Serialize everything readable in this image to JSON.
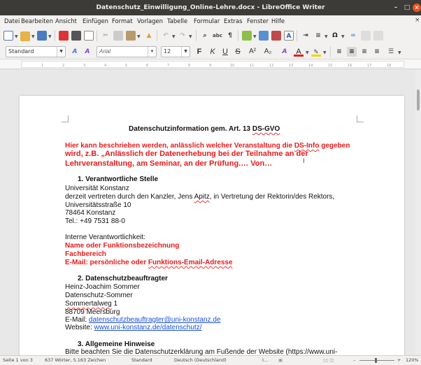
{
  "window": {
    "title": "Datenschutz_Einwilligung_Online-Lehre.docx - LibreOffice Writer",
    "min": "–",
    "max": "□",
    "close": "×"
  },
  "menu": [
    "Datei",
    "Bearbeiten",
    "Ansicht",
    "Einfügen",
    "Format",
    "Vorlagen",
    "Tabelle",
    "Formular",
    "Extras",
    "Fenster",
    "Hilfe"
  ],
  "menu_close": "×",
  "toolbar2": {
    "paragraph_style": "Standard",
    "font_name": "Arial",
    "font_size": "12",
    "bold": "F",
    "italic": "K",
    "underline": "U",
    "strike": "S",
    "superscript": "A²",
    "subscript": "A₂",
    "font_color": "A",
    "highlight": "✎"
  },
  "ruler": [
    "1",
    "2",
    "3",
    "4",
    "5",
    "6",
    "7",
    "8",
    "9",
    "10",
    "11",
    "12",
    "13",
    "14",
    "15",
    "16",
    "17",
    "18"
  ],
  "document": {
    "title": "Datenschutzinformation gem. Art. 13 ",
    "title_tail": "DS-GVO",
    "intro_1a": "Hier kann beschrieben werden, anlässlich welcher Veranstaltung die ",
    "intro_1b": "DS-Info",
    "intro_1c": " gegeben",
    "intro_2": "wird, z.B. „Anlässlich der Datenerhebung bei der Teilnahme an der",
    "intro_3": "Lehrveranstaltung, am Seminar, an der Prüfung.… Von…",
    "s1_heading": "1.   Verantwortliche Stelle",
    "s1_l1": "Universität Konstanz",
    "s1_l2a": "derzeit vertreten durch den Kanzler, Jens ",
    "s1_l2b": "Apitz",
    "s1_l2c": ", in Vertretung der Rektorin/des Rektors,",
    "s1_l3": "Universitätsstraße 10",
    "s1_l4": "78464 Konstanz",
    "s1_l5": "Tel.: +49 7531 88-0",
    "internal_label": "Interne Verantwortlichkeit:",
    "internal_1": "Name oder Funktionsbezeichnung",
    "internal_2": "Fachbereich",
    "internal_3a": "E-Mail: persönliche oder ",
    "internal_3b": "Funktions-Email-Adresse",
    "s2_heading": "2.   Datenschutzbeauftragter",
    "s2_l1": "Heinz-Joachim Sommer",
    "s2_l2": "Datenschutz-Sommer",
    "s2_l3": "Sommertalweg",
    "s2_l3b": " 1",
    "s2_l4": "88709 Meersburg",
    "s2_l5a": "E-Mail: ",
    "s2_l5b": "datenschutzbeauftragter@uni-konstanz.de",
    "s2_l6a": "Website: ",
    "s2_l6b": "www.uni-konstanz.de/datenschutz/",
    "s3_heading": "3.   Allgemeine Hinweise",
    "s3_l1a": "Bitte beachten Sie die Datenschutzerklärung am Fußende der Website (",
    "s3_l1b": "https://www.uni-"
  },
  "status": {
    "page": "Seite 1 von 3",
    "words": "637 Wörter, 5.163 Zeichen",
    "style": "Standard",
    "lang": "Deutsch (Deutschland)",
    "insert": "I…",
    "zoom_minus": "–",
    "zoom_plus": "+",
    "zoom": "120%"
  }
}
